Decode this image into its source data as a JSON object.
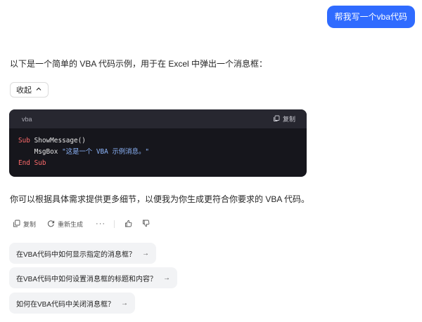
{
  "user_message": "帮我写一个vba代码",
  "reply": {
    "intro": "以下是一个简单的 VBA 代码示例，用于在 Excel 中弹出一个消息框：",
    "collapse_label": "收起",
    "code": {
      "language": "vba",
      "copy_label": "复制",
      "line1_kw": "Sub",
      "line1_rest": " ShowMessage()",
      "line2_indent": "    ",
      "line2_fn": "MsgBox",
      "line2_str": " \"这是一个 VBA 示例消息。\"",
      "line3": "End Sub"
    },
    "followup": "你可以根据具体需求提供更多细节，以便我为你生成更符合你要求的 VBA 代码。"
  },
  "actions": {
    "copy": "复制",
    "regenerate": "重新生成",
    "more": "···"
  },
  "suggestions": [
    "在VBA代码中如何显示指定的消息框？",
    "在VBA代码中如何设置消息框的标题和内容？",
    "如何在VBA代码中关闭消息框？"
  ],
  "colors": {
    "accent": "#2f6bff",
    "code_bg": "#16161c",
    "code_keyword": "#ff6b6b",
    "code_string": "#8fb8ff"
  }
}
